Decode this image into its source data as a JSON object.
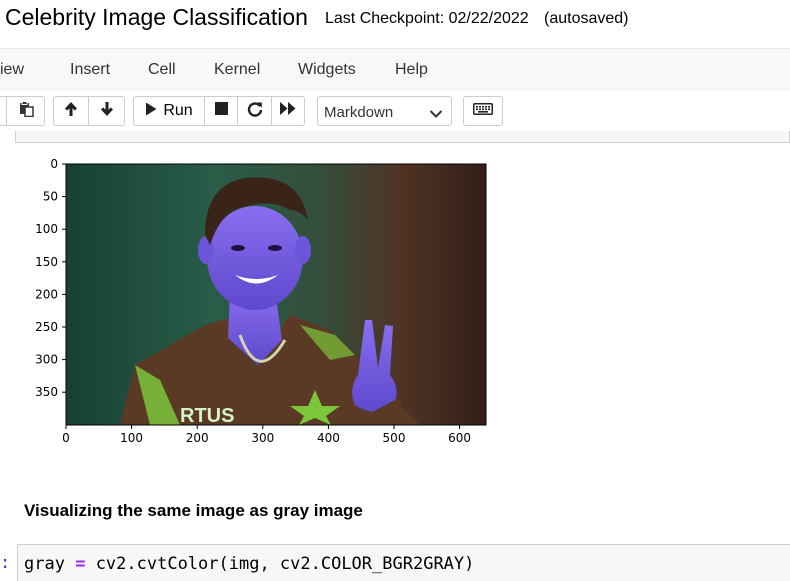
{
  "header": {
    "title": "Celebrity Image Classification",
    "checkpoint": "Last Checkpoint: 02/22/2022",
    "autosave": "(autosaved)"
  },
  "menubar": {
    "items": [
      "View",
      "Insert",
      "Cell",
      "Kernel",
      "Widgets",
      "Help"
    ],
    "visible_text": [
      "iew",
      "Insert",
      "Cell",
      "Kernel",
      "Widgets",
      "Help"
    ]
  },
  "toolbar": {
    "run_label": "Run",
    "cell_type": "Markdown",
    "buttons": [
      "paste-icon",
      "move-up-icon",
      "move-down-icon",
      "run-icon",
      "interrupt-icon",
      "restart-icon",
      "fast-forward-icon",
      "keyboard-icon"
    ]
  },
  "plot": {
    "y_ticks": [
      "0",
      "50",
      "100",
      "150",
      "200",
      "250",
      "300",
      "350"
    ],
    "x_ticks": [
      "0",
      "100",
      "200",
      "300",
      "400",
      "500",
      "600"
    ],
    "image_description": "photo of a person making a peace sign"
  },
  "markdown": {
    "text": "Visualizing the same image as gray image"
  },
  "code": {
    "prompt": ":",
    "var": "gray",
    "op": "=",
    "rest": " cv2.cvtColor(img, cv2.COLOR_BGR2GRAY)"
  },
  "colors": {
    "menubar_bg": "#f8f8f8",
    "code_bg": "#f7f7f7",
    "prompt_color": "#303f9f",
    "operator_color": "#aa22ff"
  }
}
